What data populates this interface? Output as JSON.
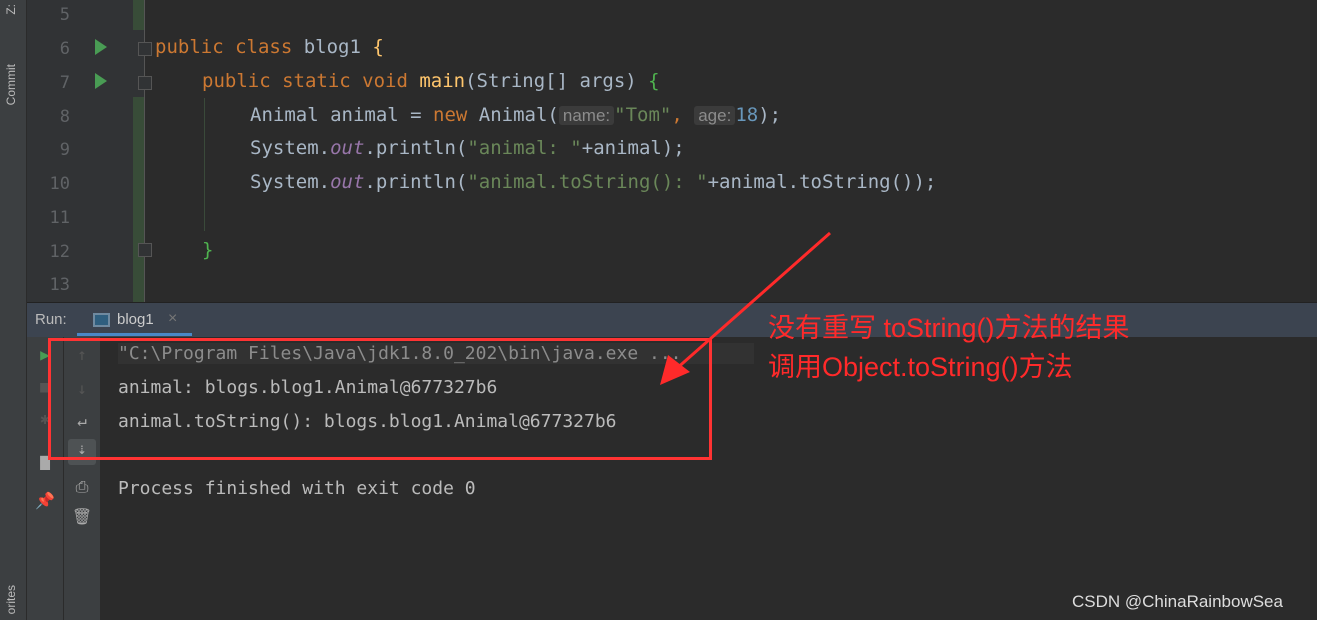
{
  "sidebar": {
    "top_label": "Z:",
    "commit_label": "Commit",
    "bottom_label": "orites"
  },
  "editor": {
    "line_numbers": [
      "5",
      "6",
      "7",
      "8",
      "9",
      "10",
      "11",
      "12",
      "13"
    ],
    "lines": {
      "l6": {
        "kw1": "public class ",
        "name": "blog1 ",
        "brace": "{"
      },
      "l7": {
        "kw1": "public static void ",
        "fn": "main",
        "rest": "(String[] args) ",
        "brace": "{"
      },
      "l8": {
        "a": "Animal animal = ",
        "kw": "new ",
        "b": "Animal(",
        "hint1": "name:",
        "s1": "\"Tom\"",
        "c": ", ",
        "hint2": "age:",
        "n": "18",
        "d": ");"
      },
      "l9": {
        "a": "System.",
        "it": "out",
        "b": ".println(",
        "s": "\"animal: \"",
        "c": "+animal);"
      },
      "l10": {
        "a": "System.",
        "it": "out",
        "b": ".println(",
        "s": "\"animal.toString(): \"",
        "c": "+animal.toString());"
      },
      "l12": {
        "brace": "}"
      }
    }
  },
  "run": {
    "label": "Run:",
    "tab": "blog1",
    "close": "×",
    "output": [
      "\"C:\\Program Files\\Java\\jdk1.8.0_202\\bin\\java.exe ...",
      "animal: blogs.blog1.Animal@677327b6",
      "animal.toString(): blogs.blog1.Animal@677327b6",
      "Process finished with exit code 0"
    ]
  },
  "annotation": {
    "line1": "没有重写 toString()方法的结果",
    "line2": "调用Object.toString()方法",
    "color": "#ff2a2a"
  },
  "watermark": "CSDN @ChinaRainbowSea"
}
